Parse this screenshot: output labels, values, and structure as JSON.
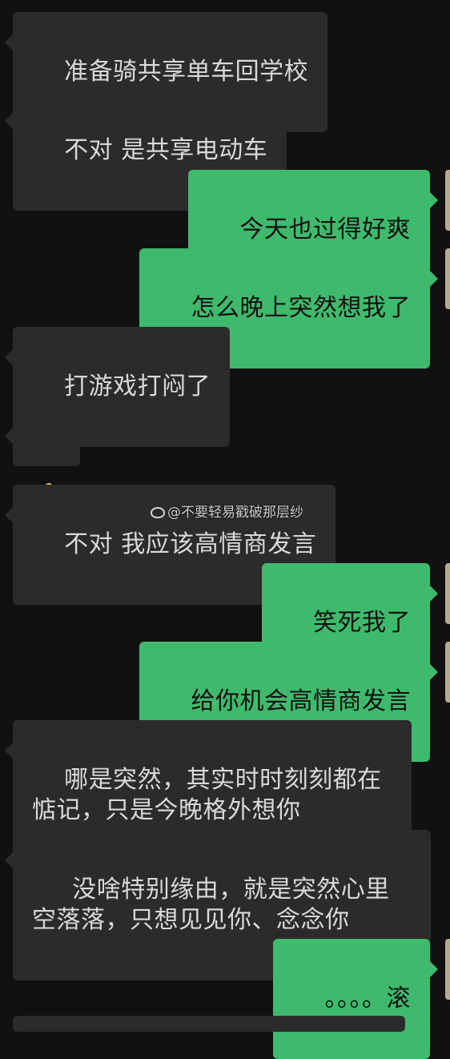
{
  "messages": [
    {
      "side": "in",
      "text": "准备骑共享单车回学校"
    },
    {
      "side": "in",
      "text": "不对 是共享电动车"
    },
    {
      "side": "out",
      "text": "今天也过得好爽"
    },
    {
      "side": "out",
      "text": "怎么晚上突然想我了"
    },
    {
      "side": "in",
      "text": "打游戏打闷了"
    },
    {
      "side": "in",
      "emoji": "thumbs-up-icon"
    },
    {
      "side": "in",
      "text": "不对 我应该高情商发言"
    },
    {
      "side": "out",
      "text": "笑死我了"
    },
    {
      "side": "out",
      "text": "给你机会高情商发言"
    },
    {
      "side": "in",
      "text": "哪是突然，其实时时刻刻都在惦记，只是今晚格外想你"
    },
    {
      "side": "in",
      "text": " 没啥特别缘由，就是突然心里空落落，只想见见你、念念你"
    },
    {
      "side": "out",
      "text": "。。。。滚"
    }
  ],
  "watermark": "@不要轻易戳破那层纱",
  "colors": {
    "background": "#111111",
    "incoming_bubble": "#2b2b2b",
    "outgoing_bubble": "#3fba6c",
    "incoming_text": "#d9d9d9",
    "outgoing_text": "#111111"
  }
}
